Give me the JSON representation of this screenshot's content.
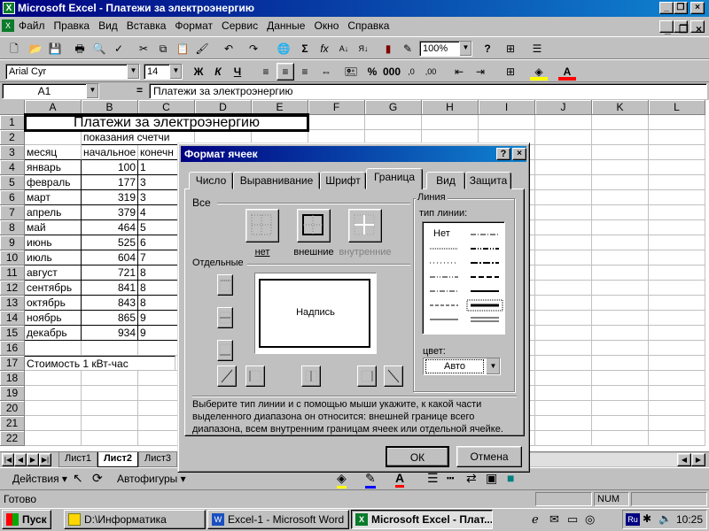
{
  "app": {
    "title": "Microsoft Excel - Платежи за электроэнергию"
  },
  "menu": [
    "Файл",
    "Правка",
    "Вид",
    "Вставка",
    "Формат",
    "Сервис",
    "Данные",
    "Окно",
    "Справка"
  ],
  "toolbar": {
    "zoom": "100%"
  },
  "formatting": {
    "font": "Arial Cyr",
    "size": "14",
    "bold": "Ж",
    "italic": "К",
    "underline": "Ч"
  },
  "formula_bar": {
    "cell_ref": "A1",
    "equals": "=",
    "content": "Платежи за электроэнергию"
  },
  "columns": [
    "A",
    "B",
    "C",
    "D",
    "E",
    "F",
    "G",
    "H",
    "I",
    "J",
    "K",
    "L"
  ],
  "rows": [
    "1",
    "2",
    "3",
    "4",
    "5",
    "6",
    "7",
    "8",
    "9",
    "10",
    "11",
    "12",
    "13",
    "14",
    "15",
    "16",
    "17",
    "18",
    "19",
    "20",
    "21",
    "22"
  ],
  "sheet": {
    "title": "Платежи за электроэнергию",
    "header2": "показания счетчи",
    "header3_a": "месяц",
    "header3_b": "начальное",
    "header3_c": "конечн",
    "months": [
      "январь",
      "февраль",
      "март",
      "апрель",
      "май",
      "июнь",
      "июль",
      "август",
      "сентябрь",
      "октябрь",
      "ноябрь",
      "декабрь"
    ],
    "values": [
      "100",
      "177",
      "319",
      "379",
      "464",
      "525",
      "604",
      "721",
      "841",
      "843",
      "865",
      "934"
    ],
    "c_partial": [
      "1",
      "3",
      "3",
      "4",
      "5",
      "6",
      "7",
      "8",
      "8",
      "8",
      "9",
      "9"
    ],
    "cost_label": "Стоимость 1 кВт-час"
  },
  "sheet_tabs": [
    "Лист1",
    "Лист2",
    "Лист3"
  ],
  "drawing_toolbar": {
    "actions": "Действия",
    "autoshapes": "Автофигуры"
  },
  "status": {
    "ready": "Готово",
    "num": "NUM"
  },
  "dialog": {
    "title": "Формат ячеек",
    "help": "?",
    "tabs": [
      "Число",
      "Выравнивание",
      "Шрифт",
      "Граница",
      "Вид",
      "Защита"
    ],
    "active_tab": "Граница",
    "presets_label": "Все",
    "presets": [
      "нет",
      "внешние",
      "внутренние"
    ],
    "individual_label": "Отдельные",
    "preview_text": "Надпись",
    "line_group": "Линия",
    "line_type_label": "тип линии:",
    "line_none": "Нет",
    "color_label": "цвет:",
    "color_value": "Авто",
    "hint": "Выберите тип линии и с помощью мыши укажите, к какой части выделенного диапазона он относится: внешней границе всего диапазона, всем внутренним границам ячеек или отдельной ячейке.",
    "ok": "ОК",
    "cancel": "Отмена"
  },
  "taskbar": {
    "start": "Пуск",
    "items": [
      "D:\\Информатика",
      "Excel-1 - Microsoft Word",
      "Microsoft Excel - Плат..."
    ],
    "lang": "Ru",
    "time": "10:25"
  }
}
